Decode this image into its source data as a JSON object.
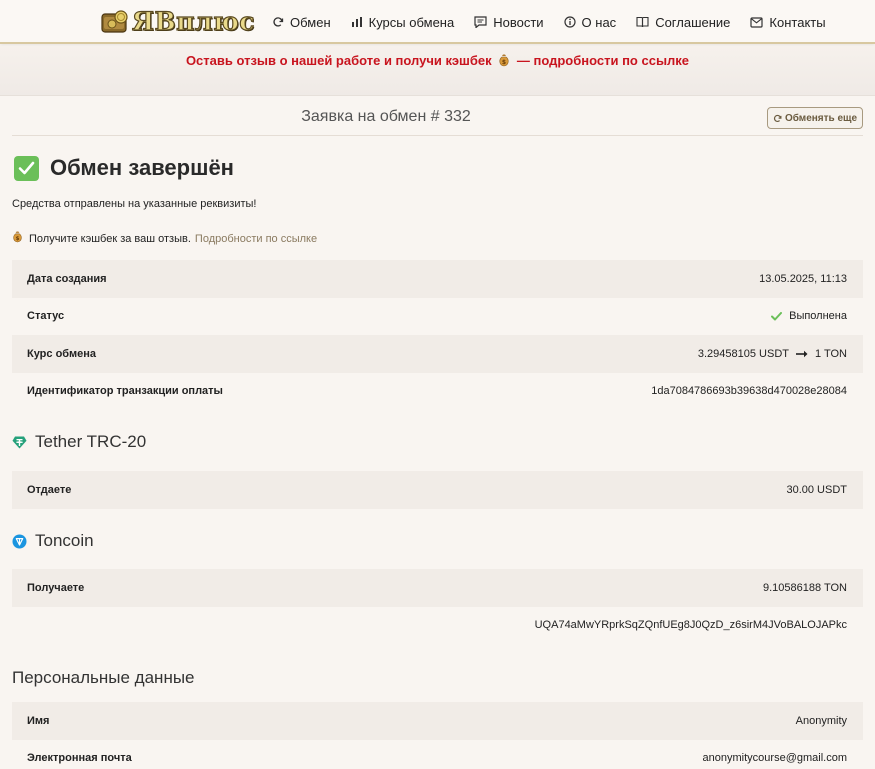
{
  "header": {
    "logo_text": "ЯВплюс",
    "nav": [
      {
        "label": "Обмен",
        "icon": "refresh-icon"
      },
      {
        "label": "Курсы обмена",
        "icon": "bar-chart-icon"
      },
      {
        "label": "Новости",
        "icon": "message-icon"
      },
      {
        "label": "О нас",
        "icon": "info-icon"
      },
      {
        "label": "Соглашение",
        "icon": "book-icon"
      },
      {
        "label": "Контакты",
        "icon": "mail-icon"
      }
    ]
  },
  "promo": {
    "text_before": "Оставь отзыв о нашей работе и получи кэшбек",
    "text_after": "— подробности по ссылке",
    "icon": "money-bag-icon"
  },
  "order": {
    "title": "Заявка на обмен # 332",
    "exchange_more_label": "Обменять еще",
    "status_title": "Обмен завершён",
    "sent_text": "Средства отправлены на указанные реквизиты!",
    "cashback_text": "Получите кэшбек за ваш отзыв.",
    "cashback_link": "Подробности по ссылке"
  },
  "details": [
    {
      "label": "Дата создания",
      "value": "13.05.2025, 11:13"
    },
    {
      "label": "Статус",
      "value": "Выполнена"
    },
    {
      "label": "Курс обмена",
      "value_from": "3.29458105 USDT",
      "value_to": "1 TON"
    },
    {
      "label": "Идентификатор транзакции оплаты",
      "value": "1da7084786693b39638d470028e28084"
    }
  ],
  "give": {
    "currency": "Tether TRC-20",
    "label": "Отдаете",
    "value": "30.00 USDT",
    "icon_color": "#26a17b"
  },
  "receive": {
    "currency": "Toncoin",
    "label": "Получаете",
    "value": "9.10586188 TON",
    "address": "UQA74aMwYRprkSqZQnfUEg8J0QzD_z6sirM4JVoBALOJAPkc",
    "icon_color": "#1b95e0"
  },
  "personal": {
    "title": "Персональные данные",
    "rows": [
      {
        "label": "Имя",
        "value": "Anonymity"
      },
      {
        "label": "Электронная почта",
        "value": "anonymitycourse@gmail.com"
      }
    ]
  },
  "colors": {
    "promo_red": "#c8141e",
    "check_green": "#6bbf59",
    "link_brown": "#8a7a60"
  }
}
